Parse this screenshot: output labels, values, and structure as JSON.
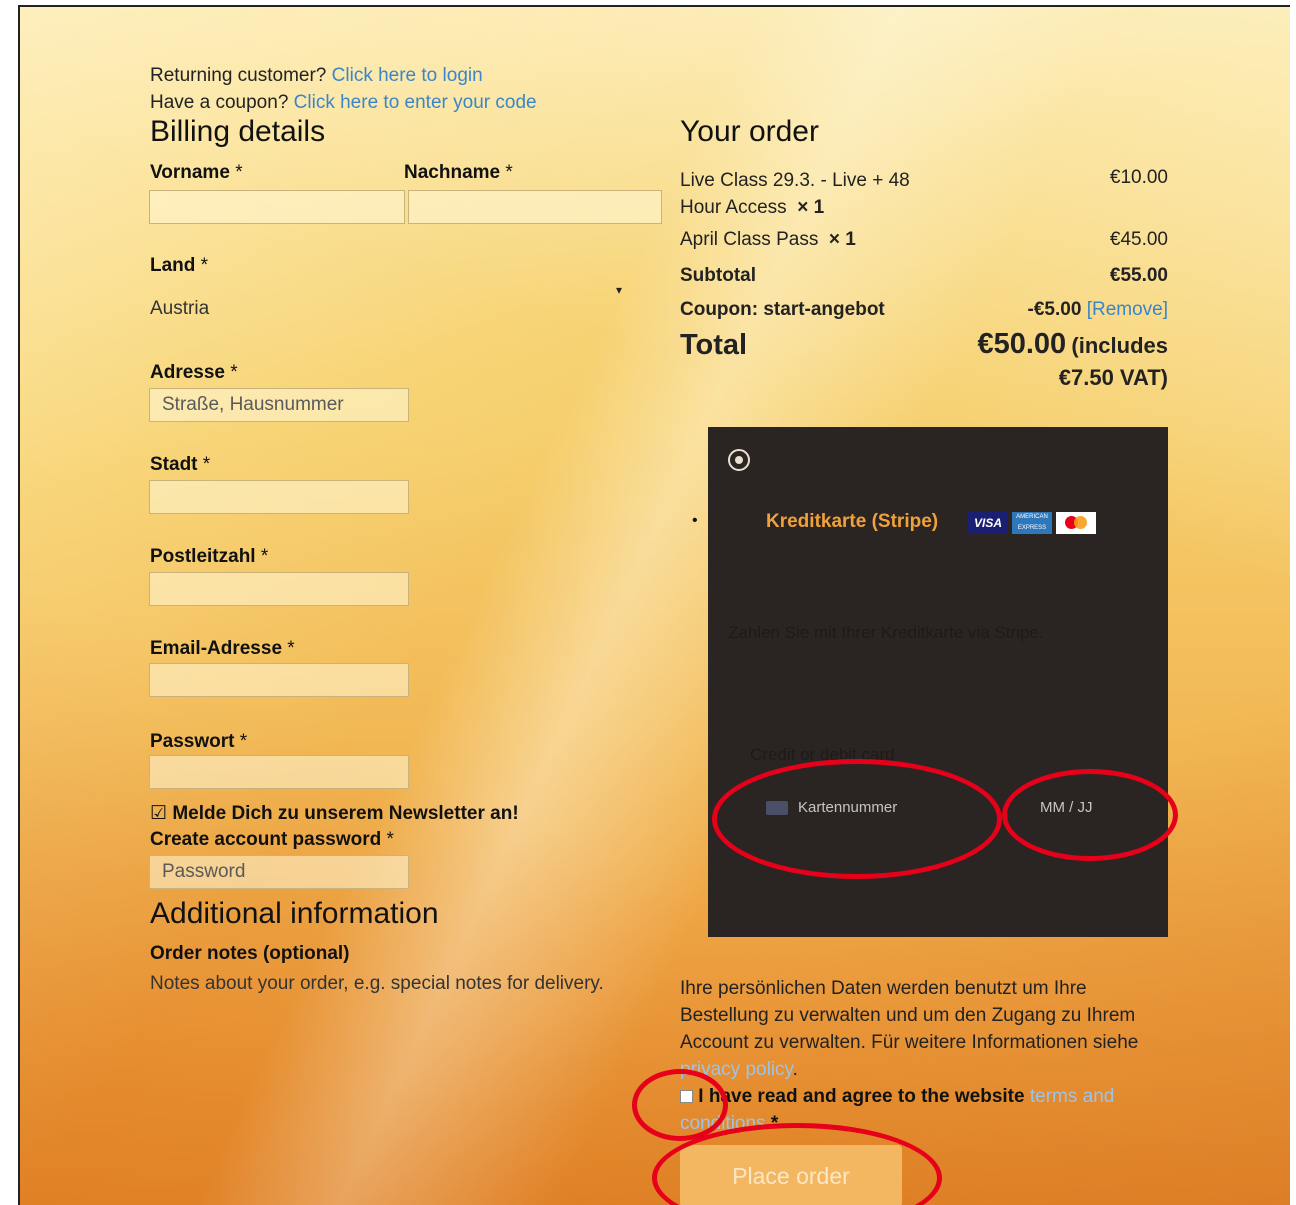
{
  "notices": {
    "returning_text": "Returning customer?",
    "returning_link": "Click here to login",
    "coupon_text": "Have a coupon?",
    "coupon_link": "Click here to enter your code"
  },
  "billing": {
    "title": "Billing details",
    "first_name_label": "Vorname",
    "last_name_label": "Nachname",
    "country_label": "Land",
    "country_value": "Austria",
    "address_label": "Adresse",
    "address_placeholder": "Straße, Hausnummer",
    "city_label": "Stadt",
    "zip_label": "Postleitzahl",
    "email_label": "Email-Adresse",
    "password_label": "Passwort",
    "required_mark": "*",
    "newsletter_check": "☑",
    "newsletter_label": "Melde Dich zu unserem Newsletter an!",
    "create_password_label": "Create account password",
    "create_password_placeholder": "Password"
  },
  "additional": {
    "title": "Additional information",
    "notes_label": "Order notes (optional)",
    "notes_placeholder": "Notes about your order, e.g. special notes for delivery."
  },
  "order": {
    "title": "Your order",
    "items": [
      {
        "name_line1": "Live Class 29.3. - Live + 48",
        "name_line2": "Hour Access",
        "qty": "× 1",
        "price": "€10.00"
      },
      {
        "name_line1": "April Class Pass",
        "qty": "× 1",
        "price": "€45.00"
      }
    ],
    "subtotal_label": "Subtotal",
    "subtotal_value": "€55.00",
    "coupon_label": "Coupon: start-angebot",
    "coupon_value": "-€5.00",
    "coupon_remove": "[Remove]",
    "total_label": "Total",
    "total_value": "€50.00",
    "total_vat_line1": "(includes",
    "total_vat_line2": "€7.50 VAT)"
  },
  "payment": {
    "method_label": "Kreditkarte (Stripe)",
    "description": "Zahlen Sie mit Ihrer Kreditkarte via Stripe.",
    "card_label": "Credit or debit card",
    "card_number_placeholder": "Kartennummer",
    "expiry_placeholder": "MM / JJ",
    "visa_text": "VISA",
    "amex_text": "AMERICAN EXPRESS",
    "bullet": "•"
  },
  "privacy": {
    "text": "Ihre persönlichen Daten werden benutzt um Ihre Bestellung zu verwalten und um den Zugang zu Ihrem Account zu verwalten. Für weitere Informationen siehe",
    "link": "privacy policy",
    "end": "."
  },
  "terms": {
    "text": "I have read and agree to the website",
    "link": "terms and conditions",
    "required_mark": "*"
  },
  "place_order_label": "Place order",
  "colors": {
    "link": "#3a86c8",
    "highlight": "#e6001a",
    "payment_bg": "#2a2522",
    "payment_title": "#f0a13a",
    "button_bg": "#f3b761"
  }
}
